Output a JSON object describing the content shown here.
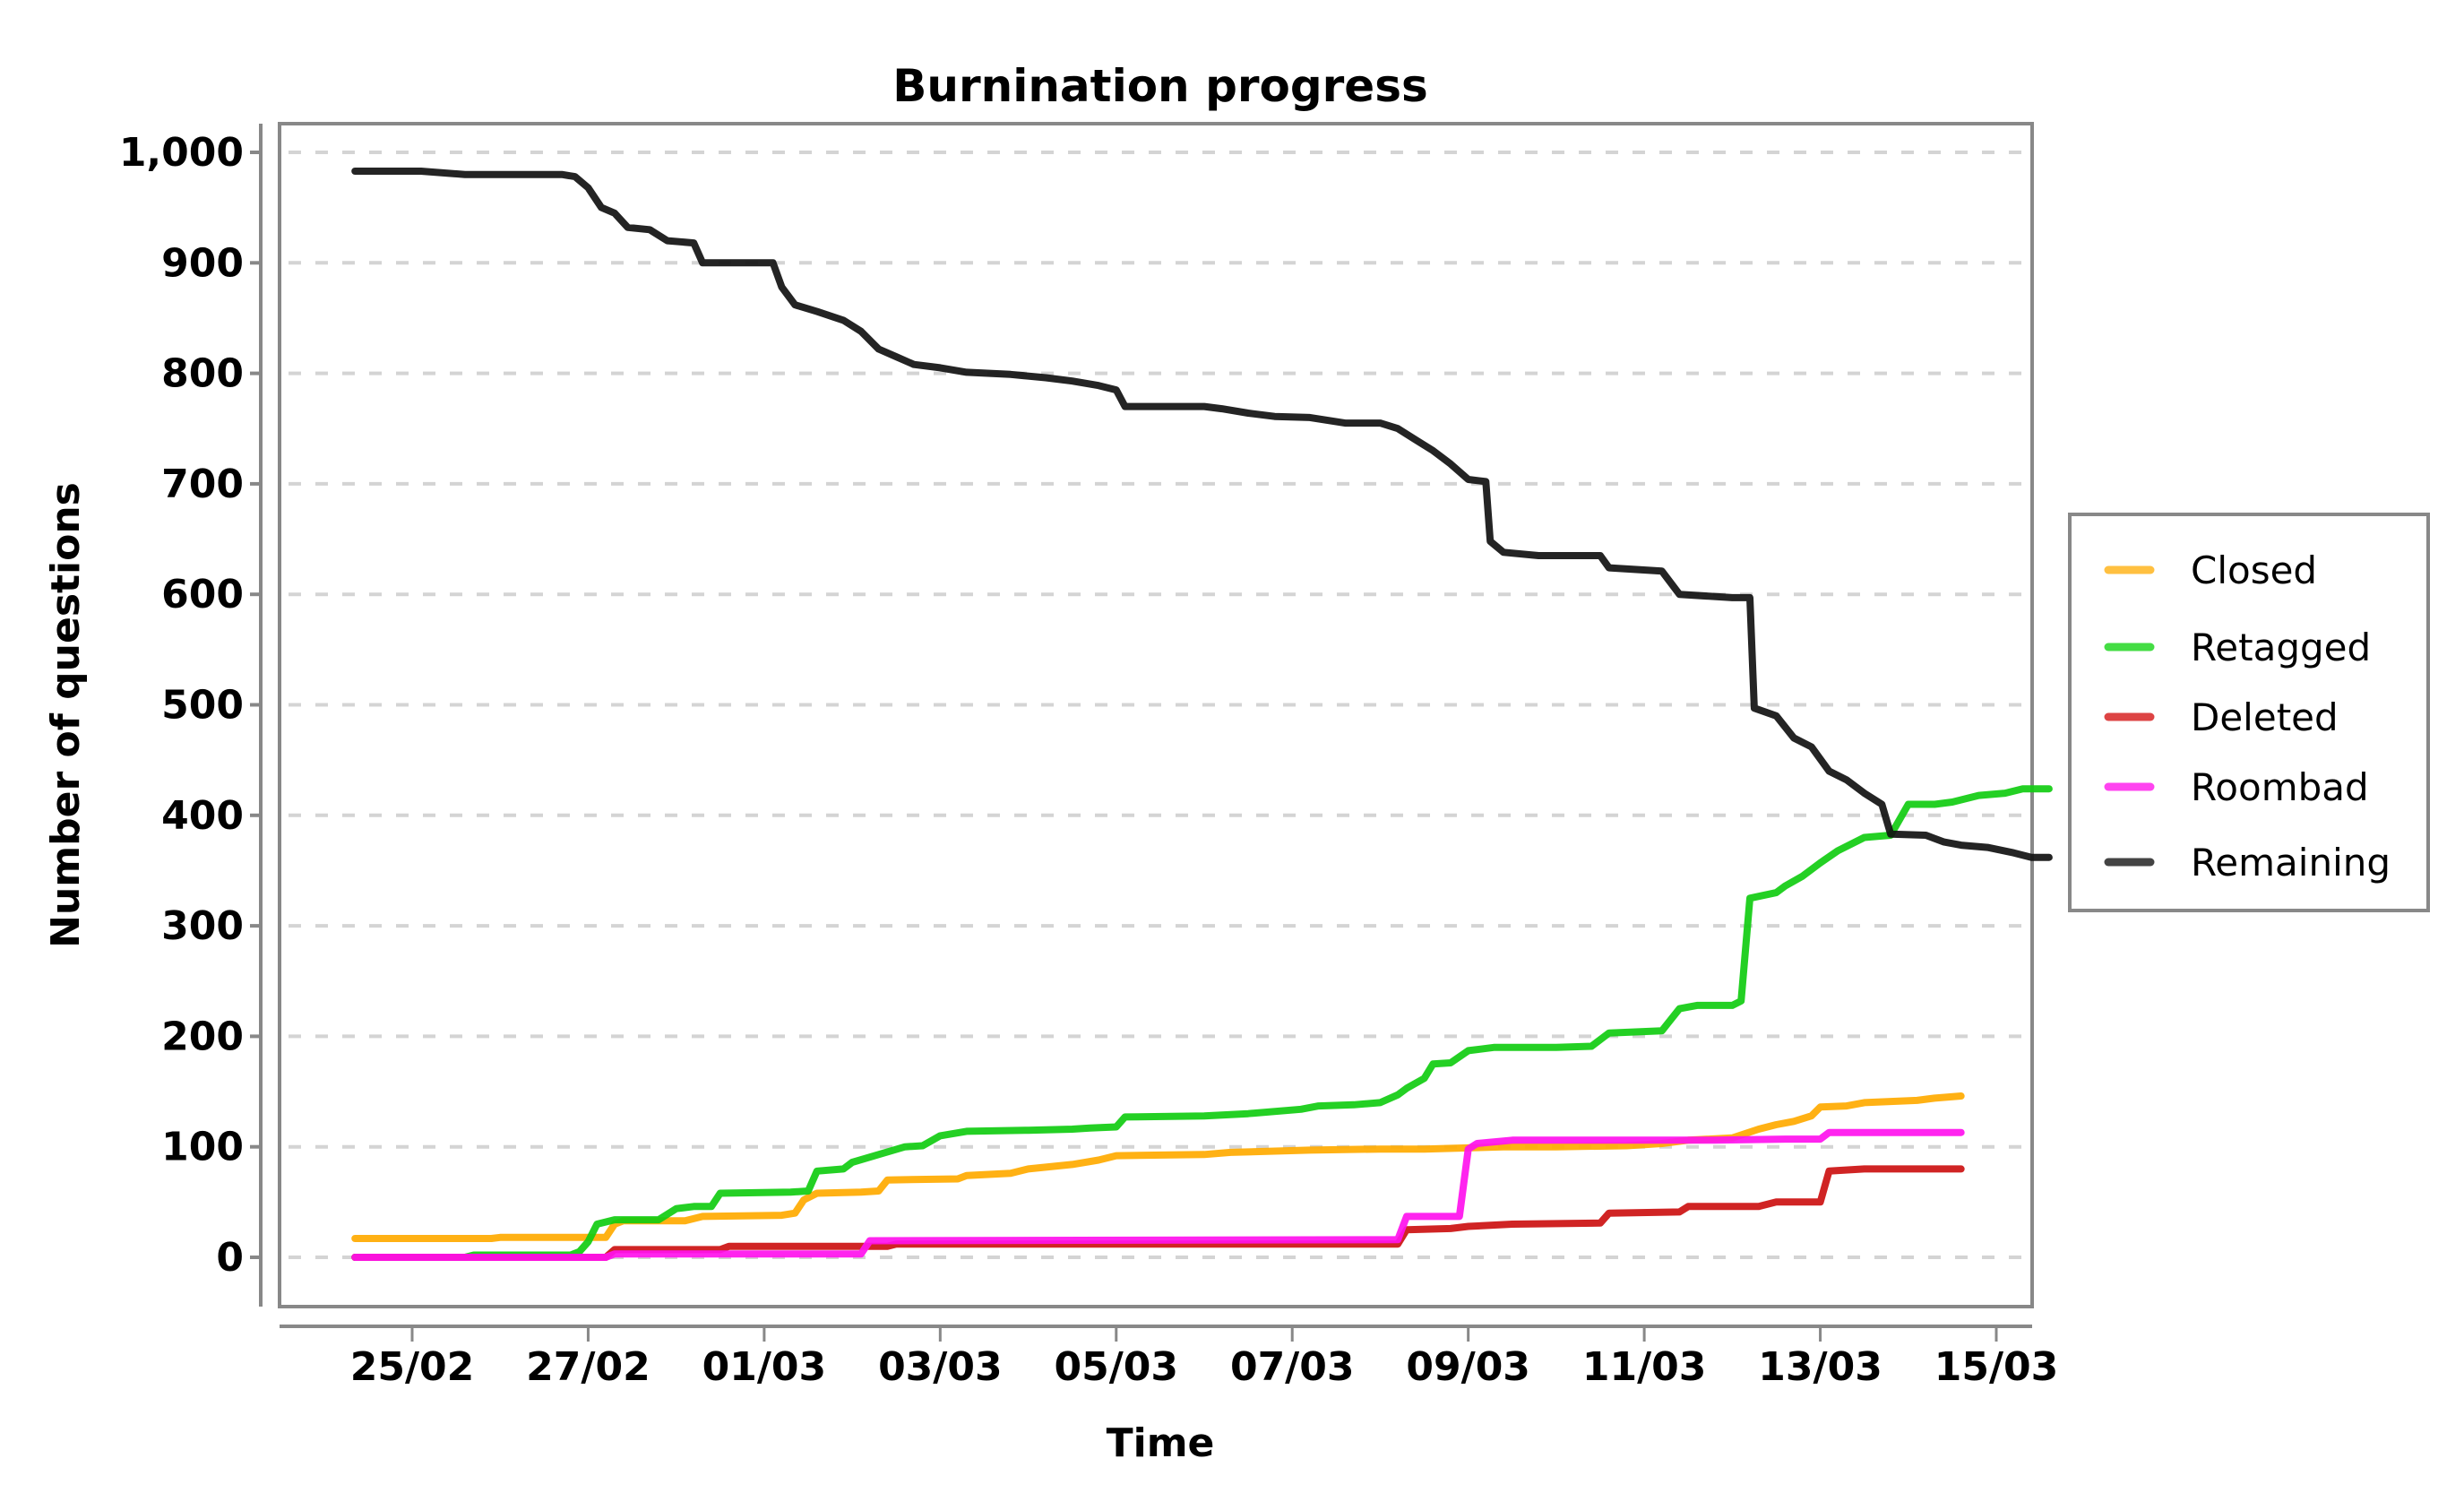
{
  "chart_data": {
    "type": "line",
    "title": "Burnination progress",
    "xlabel": "Time",
    "ylabel": "Number of questions",
    "x_unit": "days since 25/02",
    "xlim": [
      -0.8,
      18.3
    ],
    "ylim": [
      -40,
      1015
    ],
    "grid": true,
    "legend_position": "right",
    "x_ticks": [
      {
        "value": 0,
        "label": "25/02"
      },
      {
        "value": 2,
        "label": "27/02"
      },
      {
        "value": 4,
        "label": "01/03"
      },
      {
        "value": 6,
        "label": "03/03"
      },
      {
        "value": 8,
        "label": "05/03"
      },
      {
        "value": 10,
        "label": "07/03"
      },
      {
        "value": 12,
        "label": "09/03"
      },
      {
        "value": 14,
        "label": "11/03"
      },
      {
        "value": 16,
        "label": "13/03"
      },
      {
        "value": 18,
        "label": "15/03"
      }
    ],
    "y_ticks": [
      {
        "value": 0,
        "label": "0"
      },
      {
        "value": 100,
        "label": "100"
      },
      {
        "value": 200,
        "label": "200"
      },
      {
        "value": 300,
        "label": "300"
      },
      {
        "value": 400,
        "label": "400"
      },
      {
        "value": 500,
        "label": "500"
      },
      {
        "value": 600,
        "label": "600"
      },
      {
        "value": 700,
        "label": "700"
      },
      {
        "value": 800,
        "label": "800"
      },
      {
        "value": 900,
        "label": "900"
      },
      {
        "value": 1000,
        "label": "1,000"
      }
    ],
    "series": [
      {
        "name": "Closed",
        "color": "#FFAA00",
        "legend_color": "#FFC040",
        "points": [
          [
            -0.65,
            17
          ],
          [
            0.9,
            17
          ],
          [
            1.0,
            18
          ],
          [
            2.2,
            18
          ],
          [
            2.3,
            30
          ],
          [
            2.4,
            33
          ],
          [
            3.1,
            33
          ],
          [
            3.3,
            37
          ],
          [
            4.2,
            38
          ],
          [
            4.35,
            40
          ],
          [
            4.45,
            52
          ],
          [
            4.6,
            58
          ],
          [
            5.1,
            59
          ],
          [
            5.3,
            60
          ],
          [
            5.4,
            70
          ],
          [
            6.2,
            71
          ],
          [
            6.3,
            74
          ],
          [
            6.8,
            76
          ],
          [
            7.0,
            80
          ],
          [
            7.5,
            84
          ],
          [
            7.8,
            88
          ],
          [
            8.0,
            92
          ],
          [
            9.0,
            93
          ],
          [
            9.3,
            95
          ],
          [
            10.2,
            97
          ],
          [
            11.0,
            98
          ],
          [
            11.5,
            98
          ],
          [
            12.0,
            99
          ],
          [
            12.4,
            100
          ],
          [
            13.0,
            100
          ],
          [
            13.8,
            101
          ],
          [
            14.2,
            103
          ],
          [
            14.5,
            106
          ],
          [
            15.0,
            108
          ],
          [
            15.3,
            116
          ],
          [
            15.5,
            120
          ],
          [
            15.7,
            123
          ],
          [
            15.9,
            128
          ],
          [
            16.0,
            136
          ],
          [
            16.3,
            137
          ],
          [
            16.5,
            140
          ],
          [
            17.1,
            142
          ],
          [
            17.3,
            144
          ],
          [
            17.6,
            146
          ]
        ]
      },
      {
        "name": "Retagged",
        "color": "#11CC11",
        "legend_color": "#44DD44",
        "points": [
          [
            -0.65,
            0
          ],
          [
            0.6,
            0
          ],
          [
            0.7,
            2
          ],
          [
            1.8,
            2
          ],
          [
            1.9,
            5
          ],
          [
            2.0,
            14
          ],
          [
            2.1,
            30
          ],
          [
            2.3,
            34
          ],
          [
            2.8,
            34
          ],
          [
            3.0,
            44
          ],
          [
            3.2,
            46
          ],
          [
            3.4,
            46
          ],
          [
            3.5,
            58
          ],
          [
            4.3,
            59
          ],
          [
            4.5,
            60
          ],
          [
            4.6,
            78
          ],
          [
            4.9,
            80
          ],
          [
            5.0,
            86
          ],
          [
            5.3,
            93
          ],
          [
            5.6,
            100
          ],
          [
            5.8,
            101
          ],
          [
            6.0,
            110
          ],
          [
            6.3,
            114
          ],
          [
            7.0,
            115
          ],
          [
            7.5,
            116
          ],
          [
            7.7,
            117
          ],
          [
            8.0,
            118
          ],
          [
            8.1,
            127
          ],
          [
            9.0,
            128
          ],
          [
            9.5,
            130
          ],
          [
            10.1,
            134
          ],
          [
            10.3,
            137
          ],
          [
            10.7,
            138
          ],
          [
            11.0,
            140
          ],
          [
            11.2,
            147
          ],
          [
            11.3,
            153
          ],
          [
            11.5,
            162
          ],
          [
            11.6,
            175
          ],
          [
            11.8,
            176
          ],
          [
            12.0,
            187
          ],
          [
            12.3,
            190
          ],
          [
            13.0,
            190
          ],
          [
            13.4,
            191
          ],
          [
            13.6,
            203
          ],
          [
            14.2,
            205
          ],
          [
            14.4,
            225
          ],
          [
            14.6,
            228
          ],
          [
            15.0,
            228
          ],
          [
            15.1,
            232
          ],
          [
            15.2,
            325
          ],
          [
            15.5,
            330
          ],
          [
            15.6,
            336
          ],
          [
            15.8,
            345
          ],
          [
            16.0,
            357
          ],
          [
            16.2,
            368
          ],
          [
            16.5,
            380
          ],
          [
            16.8,
            382
          ],
          [
            17.0,
            410
          ],
          [
            17.3,
            410
          ],
          [
            17.5,
            412
          ],
          [
            17.8,
            418
          ],
          [
            18.1,
            420
          ],
          [
            18.3,
            424
          ],
          [
            18.6,
            424
          ]
        ]
      },
      {
        "name": "Deleted",
        "color": "#CC1111",
        "legend_color": "#DD4444",
        "points": [
          [
            -0.65,
            0
          ],
          [
            2.2,
            0
          ],
          [
            2.3,
            7
          ],
          [
            3.5,
            7
          ],
          [
            3.6,
            10
          ],
          [
            5.4,
            10
          ],
          [
            5.5,
            12
          ],
          [
            11.2,
            12
          ],
          [
            11.3,
            25
          ],
          [
            11.8,
            26
          ],
          [
            12.0,
            28
          ],
          [
            12.5,
            30
          ],
          [
            13.5,
            31
          ],
          [
            13.6,
            40
          ],
          [
            14.4,
            41
          ],
          [
            14.5,
            46
          ],
          [
            15.3,
            46
          ],
          [
            15.5,
            50
          ],
          [
            16.0,
            50
          ],
          [
            16.1,
            78
          ],
          [
            16.5,
            80
          ],
          [
            17.6,
            80
          ]
        ]
      },
      {
        "name": "Roombad",
        "color": "#FF11EE",
        "legend_color": "#FF44F0",
        "points": [
          [
            -0.65,
            0
          ],
          [
            2.2,
            0
          ],
          [
            2.3,
            3
          ],
          [
            5.1,
            3
          ],
          [
            5.2,
            15
          ],
          [
            11.2,
            16
          ],
          [
            11.3,
            37
          ],
          [
            11.9,
            37
          ],
          [
            12.0,
            98
          ],
          [
            12.1,
            103
          ],
          [
            12.5,
            106
          ],
          [
            14.8,
            106
          ],
          [
            15.6,
            107
          ],
          [
            16.0,
            107
          ],
          [
            16.1,
            113
          ],
          [
            17.6,
            113
          ]
        ]
      },
      {
        "name": "Remaining",
        "color": "#111111",
        "legend_color": "#444444",
        "points": [
          [
            -0.65,
            983
          ],
          [
            0.1,
            983
          ],
          [
            0.6,
            980
          ],
          [
            1.7,
            980
          ],
          [
            1.85,
            978
          ],
          [
            2.0,
            968
          ],
          [
            2.15,
            950
          ],
          [
            2.3,
            945
          ],
          [
            2.45,
            932
          ],
          [
            2.7,
            930
          ],
          [
            2.9,
            920
          ],
          [
            3.2,
            918
          ],
          [
            3.3,
            900
          ],
          [
            4.1,
            900
          ],
          [
            4.2,
            878
          ],
          [
            4.35,
            862
          ],
          [
            4.6,
            856
          ],
          [
            4.9,
            848
          ],
          [
            5.1,
            838
          ],
          [
            5.3,
            822
          ],
          [
            5.5,
            815
          ],
          [
            5.7,
            808
          ],
          [
            6.0,
            805
          ],
          [
            6.3,
            801
          ],
          [
            6.8,
            799
          ],
          [
            7.2,
            796
          ],
          [
            7.5,
            793
          ],
          [
            7.8,
            789
          ],
          [
            8.0,
            785
          ],
          [
            8.1,
            770
          ],
          [
            9.0,
            770
          ],
          [
            9.2,
            768
          ],
          [
            9.5,
            764
          ],
          [
            9.8,
            761
          ],
          [
            10.2,
            760
          ],
          [
            10.6,
            755
          ],
          [
            11.0,
            755
          ],
          [
            11.2,
            750
          ],
          [
            11.4,
            740
          ],
          [
            11.6,
            730
          ],
          [
            11.8,
            718
          ],
          [
            12.0,
            704
          ],
          [
            12.2,
            702
          ],
          [
            12.25,
            648
          ],
          [
            12.4,
            638
          ],
          [
            12.8,
            635
          ],
          [
            13.5,
            635
          ],
          [
            13.6,
            624
          ],
          [
            14.2,
            621
          ],
          [
            14.4,
            600
          ],
          [
            15.0,
            597
          ],
          [
            15.2,
            597
          ],
          [
            15.25,
            497
          ],
          [
            15.5,
            490
          ],
          [
            15.7,
            470
          ],
          [
            15.9,
            462
          ],
          [
            16.1,
            440
          ],
          [
            16.3,
            432
          ],
          [
            16.5,
            420
          ],
          [
            16.7,
            410
          ],
          [
            16.8,
            383
          ],
          [
            17.2,
            382
          ],
          [
            17.4,
            376
          ],
          [
            17.6,
            373
          ],
          [
            17.9,
            371
          ],
          [
            18.2,
            366
          ],
          [
            18.4,
            362
          ],
          [
            18.6,
            362
          ]
        ]
      }
    ]
  }
}
